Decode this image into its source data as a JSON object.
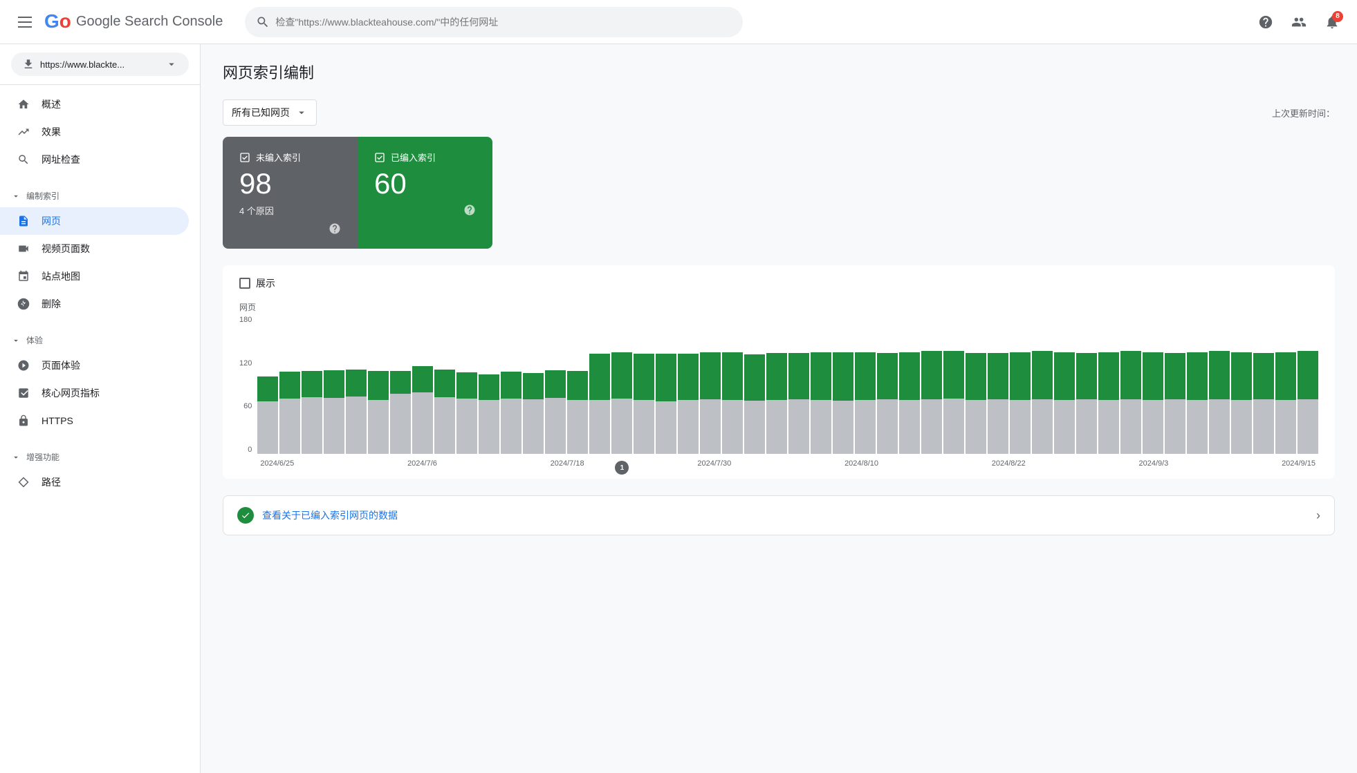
{
  "header": {
    "menu_icon": "menu",
    "logo": {
      "text": "Google Search Console",
      "letters": [
        "G",
        "o",
        "o",
        "g",
        "l",
        "e"
      ]
    },
    "search_placeholder": "检查\"https://www.blackteahouse.com/\"中的任何网址",
    "help_icon": "help",
    "user_icon": "person",
    "notification_icon": "bell",
    "notification_count": "8"
  },
  "sidebar": {
    "property": {
      "label": "https://www.blackte...",
      "icon": "download"
    },
    "nav": [
      {
        "id": "overview",
        "label": "概述",
        "icon": "home",
        "active": false,
        "section": null
      },
      {
        "id": "performance",
        "label": "效果",
        "icon": "trending_up",
        "active": false,
        "section": null
      },
      {
        "id": "url_inspection",
        "label": "网址检查",
        "icon": "search",
        "active": false,
        "section": null
      },
      {
        "id": "indexing",
        "label": "编制索引",
        "icon": null,
        "active": false,
        "section": "编制索引",
        "collapsed": false
      },
      {
        "id": "pages",
        "label": "网页",
        "icon": "pages",
        "active": true,
        "section": "编制索引"
      },
      {
        "id": "video_pages",
        "label": "视频页面数",
        "icon": "video",
        "active": false,
        "section": "编制索引"
      },
      {
        "id": "sitemap",
        "label": "站点地图",
        "icon": "sitemap",
        "active": false,
        "section": "编制索引"
      },
      {
        "id": "removals",
        "label": "删除",
        "icon": "block",
        "active": false,
        "section": "编制索引"
      },
      {
        "id": "experience",
        "label": "体验",
        "icon": null,
        "active": false,
        "section": "体验",
        "collapsed": false
      },
      {
        "id": "page_experience",
        "label": "页面体验",
        "icon": "speed",
        "active": false,
        "section": "体验"
      },
      {
        "id": "core_web_vitals",
        "label": "核心网页指标",
        "icon": "vitals",
        "active": false,
        "section": "体验"
      },
      {
        "id": "https",
        "label": "HTTPS",
        "icon": "lock",
        "active": false,
        "section": "体验"
      },
      {
        "id": "enhancements",
        "label": "增强功能",
        "icon": null,
        "active": false,
        "section": "增强功能",
        "collapsed": false
      },
      {
        "id": "breadcrumbs",
        "label": "路径",
        "icon": "diamond",
        "active": false,
        "section": "增强功能"
      }
    ]
  },
  "main": {
    "page_title": "网页索引编制",
    "filter": {
      "label": "所有已知网页",
      "icon": "dropdown"
    },
    "last_updated": "上次更新时间：",
    "stats": {
      "not_indexed": {
        "label": "未编入索引",
        "count": "98",
        "sub": "4 个原因"
      },
      "indexed": {
        "label": "已编入索引",
        "count": "60",
        "sub": ""
      }
    },
    "chart": {
      "legend_label": "展示",
      "y_axis_label": "网页",
      "y_axis_values": [
        "180",
        "120",
        "60",
        "0"
      ],
      "x_axis_labels": [
        "2024/6/25",
        "2024/7/6",
        "2024/7/18",
        "2024/7/30",
        "2024/8/10",
        "2024/8/22",
        "2024/9/3",
        "2024/9/15"
      ],
      "bars": [
        {
          "indexed": 32,
          "not_indexed": 68
        },
        {
          "indexed": 35,
          "not_indexed": 72
        },
        {
          "indexed": 34,
          "not_indexed": 74
        },
        {
          "indexed": 36,
          "not_indexed": 73
        },
        {
          "indexed": 35,
          "not_indexed": 75
        },
        {
          "indexed": 38,
          "not_indexed": 70
        },
        {
          "indexed": 30,
          "not_indexed": 78
        },
        {
          "indexed": 34,
          "not_indexed": 80
        },
        {
          "indexed": 36,
          "not_indexed": 74
        },
        {
          "indexed": 34,
          "not_indexed": 72
        },
        {
          "indexed": 33,
          "not_indexed": 70
        },
        {
          "indexed": 35,
          "not_indexed": 72
        },
        {
          "indexed": 34,
          "not_indexed": 71
        },
        {
          "indexed": 36,
          "not_indexed": 73
        },
        {
          "indexed": 38,
          "not_indexed": 70
        },
        {
          "indexed": 60,
          "not_indexed": 70
        },
        {
          "indexed": 60,
          "not_indexed": 72
        },
        {
          "indexed": 60,
          "not_indexed": 70
        },
        {
          "indexed": 62,
          "not_indexed": 68
        },
        {
          "indexed": 60,
          "not_indexed": 70
        },
        {
          "indexed": 61,
          "not_indexed": 71
        },
        {
          "indexed": 62,
          "not_indexed": 70
        },
        {
          "indexed": 60,
          "not_indexed": 69
        },
        {
          "indexed": 61,
          "not_indexed": 70
        },
        {
          "indexed": 60,
          "not_indexed": 71
        },
        {
          "indexed": 62,
          "not_indexed": 70
        },
        {
          "indexed": 63,
          "not_indexed": 69
        },
        {
          "indexed": 62,
          "not_indexed": 70
        },
        {
          "indexed": 60,
          "not_indexed": 71
        },
        {
          "indexed": 62,
          "not_indexed": 70
        },
        {
          "indexed": 63,
          "not_indexed": 71
        },
        {
          "indexed": 62,
          "not_indexed": 72
        },
        {
          "indexed": 61,
          "not_indexed": 70
        },
        {
          "indexed": 60,
          "not_indexed": 71
        },
        {
          "indexed": 62,
          "not_indexed": 70
        },
        {
          "indexed": 63,
          "not_indexed": 71
        },
        {
          "indexed": 62,
          "not_indexed": 70
        },
        {
          "indexed": 60,
          "not_indexed": 71
        },
        {
          "indexed": 62,
          "not_indexed": 70
        },
        {
          "indexed": 63,
          "not_indexed": 71
        },
        {
          "indexed": 62,
          "not_indexed": 70
        },
        {
          "indexed": 60,
          "not_indexed": 71
        },
        {
          "indexed": 62,
          "not_indexed": 70
        },
        {
          "indexed": 63,
          "not_indexed": 71
        },
        {
          "indexed": 62,
          "not_indexed": 70
        },
        {
          "indexed": 60,
          "not_indexed": 71
        },
        {
          "indexed": 62,
          "not_indexed": 70
        },
        {
          "indexed": 63,
          "not_indexed": 71
        }
      ],
      "annotation_index": 16,
      "annotation_label": "1"
    },
    "data_link": {
      "text": "查看关于已编入索引网页的数据",
      "icon": "check_circle"
    }
  },
  "colors": {
    "indexed": "#1e8e3e",
    "not_indexed": "#bdc1c6",
    "active_nav": "#e8f0fe",
    "active_nav_text": "#1a73e8",
    "brand_blue": "#1a73e8"
  }
}
